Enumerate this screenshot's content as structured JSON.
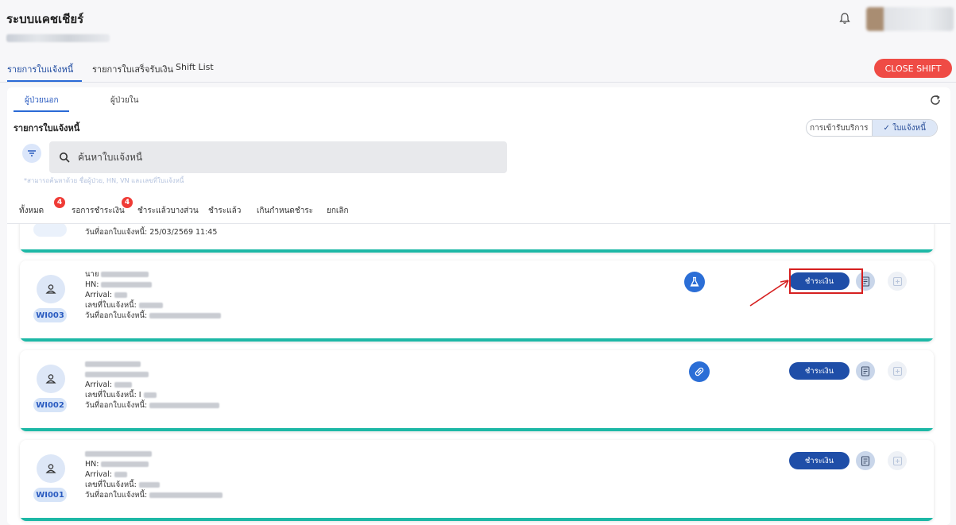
{
  "app": {
    "title": "ระบบแคชเชียร์"
  },
  "top_tabs": {
    "items": [
      "รายการใบแจ้งหนี้",
      "รายการใบเสร็จรับเงิน",
      "Shift List"
    ],
    "active": 0
  },
  "close_shift_label": "CLOSE SHIFT",
  "sub_tabs": {
    "items": [
      "ผู้ป่วยนอก",
      "ผู้ป่วยใน"
    ],
    "active": 0
  },
  "section_title": "รายการใบแจ้งหนี้",
  "view_toggle": {
    "options": [
      "การเข้ารับบริการ",
      "✓ ใบแจ้งหนี้"
    ],
    "selected": 1
  },
  "search": {
    "placeholder": "ค้นหาใบแจ้งหนี้",
    "hint": "*สามารถค้นหาด้วย ชื่อผู้ป่วย, HN, VN และเลขที่ใบแจ้งหนี้"
  },
  "status_tabs": [
    {
      "label": "ทั้งหมด",
      "count": "4"
    },
    {
      "label": "รอการชำระเงิน",
      "count": "4"
    },
    {
      "label": "ชำระแล้วบางส่วน",
      "count": ""
    },
    {
      "label": "ชำระแล้ว",
      "count": ""
    },
    {
      "label": "เกินกำหนดชำระ",
      "count": ""
    },
    {
      "label": "ยกเลิก",
      "count": ""
    }
  ],
  "cards": {
    "partial_top": {
      "date_label": "วันที่ออกใบแจ้งหนี้: 25/03/2569 11:45"
    },
    "card1": {
      "code": "WI003",
      "prefix": "นาย",
      "hn_label": "HN:",
      "arrival_label": "Arrival:",
      "invoice_no_label": "เลขที่ใบแจ้งหนี้:",
      "date_label": "วันที่ออกใบแจ้งหนี้:",
      "type_icon": "flask-icon",
      "pay_label": "ชำระเงิน"
    },
    "card2": {
      "code": "WI002",
      "arrival_label": "Arrival:",
      "invoice_no_label": "เลขที่ใบแจ้งหนี้: I",
      "date_label": "วันที่ออกใบแจ้งหนี้:",
      "type_icon": "pill-icon",
      "pay_label": "ชำระเงิน"
    },
    "card3": {
      "code": "WI001",
      "hn_label": "HN:",
      "arrival_label": "Arrival:",
      "invoice_no_label": "เลขที่ใบแจ้งหนี้:",
      "date_label": "วันที่ออกใบแจ้งหนี้:",
      "pay_label": "ชำระเงิน"
    }
  },
  "colors": {
    "accent": "#1f4ea8",
    "close_shift": "#ef4b45",
    "card_bar": "#1db8a6",
    "highlight": "#d62020"
  }
}
